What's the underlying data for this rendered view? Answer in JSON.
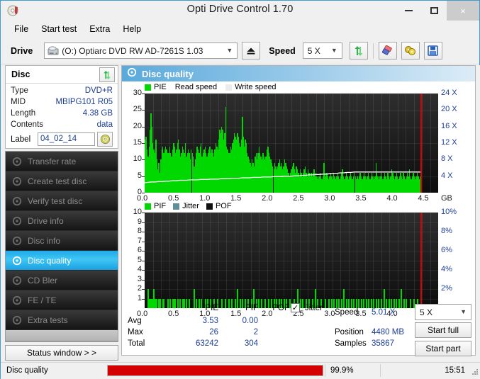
{
  "window": {
    "title": "Opti Drive Control 1.70",
    "icon": "disc-icon",
    "minimize_label": "minimize",
    "maximize_label": "maximize",
    "close_label": "×"
  },
  "menu": {
    "items": [
      "File",
      "Start test",
      "Extra",
      "Help"
    ]
  },
  "toolbar": {
    "drive_label": "Drive",
    "drive_value": "(O:)   Optiarc DVD RW AD-7261S 1.03",
    "eject_icon": "eject-icon",
    "speed_label": "Speed",
    "speed_value": "5 X",
    "refresh_icon": "refresh-arrows-icon",
    "eraser_icon": "eraser-icon",
    "compare_icon": "compare-icon",
    "save_icon": "save-floppy-icon"
  },
  "disc": {
    "header": "Disc",
    "refresh_icon": "refresh-arrows-icon",
    "rows": [
      {
        "key": "Type",
        "value": "DVD+R"
      },
      {
        "key": "MID",
        "value": "MBIPG101 R05"
      },
      {
        "key": "Length",
        "value": "4.38 GB"
      },
      {
        "key": "Contents",
        "value": "data"
      }
    ],
    "label_key": "Label",
    "label_value": "04_02_14",
    "label_placeholder": "",
    "cd_button_icon": "cd-disc-icon"
  },
  "nav": {
    "items": [
      {
        "label": "Transfer rate",
        "icon": "disc-icon",
        "selected": false
      },
      {
        "label": "Create test disc",
        "icon": "disc-icon",
        "selected": false
      },
      {
        "label": "Verify test disc",
        "icon": "disc-icon",
        "selected": false
      },
      {
        "label": "Drive info",
        "icon": "disc-icon",
        "selected": false
      },
      {
        "label": "Disc info",
        "icon": "disc-icon",
        "selected": false
      },
      {
        "label": "Disc quality",
        "icon": "disc-icon",
        "selected": true
      },
      {
        "label": "CD Bler",
        "icon": "disc-icon",
        "selected": false
      },
      {
        "label": "FE / TE",
        "icon": "disc-icon",
        "selected": false
      },
      {
        "label": "Extra tests",
        "icon": "disc-icon",
        "selected": false
      }
    ],
    "status_window_label": "Status window > >"
  },
  "panel": {
    "title": "Disc quality",
    "icon": "disc-quality-icon"
  },
  "stats": {
    "columns": [
      "PIE",
      "PIF",
      "POF"
    ],
    "rows": [
      {
        "label": "Avg",
        "pie": "3.53",
        "pif": "0.00",
        "pof": ""
      },
      {
        "label": "Max",
        "pie": "26",
        "pif": "2",
        "pof": ""
      },
      {
        "label": "Total",
        "pie": "63242",
        "pif": "304",
        "pof": ""
      }
    ],
    "jitter_label": "Jitter",
    "jitter_checked": true,
    "speed_label": "Speed",
    "speed_value": "5.01 X",
    "position_label": "Position",
    "position_value": "4480 MB",
    "samples_label": "Samples",
    "samples_value": "35867",
    "speed_select_value": "5 X",
    "start_full_label": "Start full",
    "start_part_label": "Start part"
  },
  "statusbar": {
    "task": "Disc quality",
    "progress_text": "99.9%",
    "progress_pct": 99.9,
    "time": "15:51"
  },
  "colors": {
    "pie_green": "#00d800",
    "pif_green": "#00d800",
    "jitter_blue": "#5f8f99",
    "pof_black": "#101010",
    "read_speed_white": "#ffffff",
    "accent_blue": "#1fa9e8",
    "progress_red": "#d40000",
    "value_blue": "#1c3f94"
  },
  "chart_data": [
    {
      "type": "area",
      "id": "pie-chart",
      "title": "",
      "legend": [
        {
          "label": "PIE",
          "color": "#00d800",
          "swatch": true
        },
        {
          "label": "Read speed",
          "color": "#ffffff",
          "swatch": false
        },
        {
          "label": "Write speed",
          "color": "#e8e8e8",
          "swatch": true
        }
      ],
      "xlabel": "GB",
      "ylabel": "",
      "xlim": [
        0,
        4.7
      ],
      "ylim": [
        0,
        30
      ],
      "yticks": [
        0,
        5,
        10,
        15,
        20,
        25,
        30
      ],
      "xticks": [
        0.0,
        0.5,
        1.0,
        1.5,
        2.0,
        2.5,
        3.0,
        3.5,
        4.0,
        4.5
      ],
      "xticklabels": [
        "0.0",
        "0.5",
        "1.0",
        "1.5",
        "2.0",
        "2.5",
        "3.0",
        "3.5",
        "4.0",
        "4.5"
      ],
      "y2lim": [
        0,
        24
      ],
      "y2ticks": [
        4,
        8,
        12,
        16,
        20,
        24
      ],
      "y2ticklabels": [
        "4 X",
        "8 X",
        "12 X",
        "16 X",
        "20 X",
        "24 X"
      ],
      "grid": true,
      "end_marker_gb": 4.42,
      "series": [
        {
          "name": "PIE",
          "color": "#00d800",
          "values": [
            16,
            17,
            13,
            11,
            14,
            19,
            24,
            20,
            15,
            13,
            12,
            16,
            10,
            7,
            9,
            6,
            10,
            13,
            14,
            12,
            13,
            14,
            13,
            12,
            12,
            14,
            12,
            11,
            13,
            15,
            14,
            12,
            13,
            15,
            16,
            13,
            11,
            12,
            14,
            13,
            12,
            15,
            11,
            12,
            13,
            12,
            10,
            13,
            12,
            11,
            8,
            10,
            12,
            14,
            13,
            12,
            14,
            15,
            11,
            12,
            13,
            14,
            12,
            11,
            12,
            13,
            14,
            12,
            13,
            12,
            11,
            13,
            15,
            14,
            13,
            16,
            19,
            18,
            20,
            19,
            16,
            18,
            26,
            14,
            13,
            12,
            12,
            14,
            13,
            15,
            16,
            18,
            17,
            16,
            18,
            17,
            15,
            14,
            16,
            23,
            17,
            14,
            16,
            15,
            12,
            11,
            10,
            9,
            8,
            10,
            9,
            8,
            11,
            12,
            10,
            12,
            14,
            12,
            11,
            10,
            12,
            11,
            10,
            11,
            13,
            14,
            12,
            11,
            10,
            9,
            8,
            7,
            9,
            8,
            7,
            8,
            9,
            10,
            8,
            9,
            7,
            8,
            10,
            9,
            8,
            7,
            6,
            5,
            6,
            7,
            8,
            9,
            7,
            6,
            8,
            7,
            6,
            5,
            7,
            6,
            5,
            6,
            7,
            8,
            6,
            5,
            7,
            6,
            5,
            6,
            5,
            6,
            7,
            5,
            6,
            5,
            4,
            5,
            6,
            5,
            4,
            5,
            9,
            6,
            5,
            6,
            5,
            4,
            5,
            6,
            5,
            4,
            6,
            5,
            4,
            5,
            6,
            5,
            4,
            5,
            6,
            7,
            5,
            4,
            5,
            6,
            5,
            4,
            5,
            6,
            5,
            4,
            5,
            6,
            5,
            4,
            5,
            4,
            5,
            6,
            5,
            4,
            5,
            6,
            5,
            4,
            5,
            6,
            5,
            4,
            5,
            6,
            5,
            4,
            5,
            9,
            6,
            5,
            4,
            5,
            6,
            5,
            4,
            5,
            6,
            5,
            4,
            6,
            5,
            4,
            5,
            7,
            6,
            5,
            4,
            5,
            6,
            5,
            4,
            5,
            6,
            5,
            4,
            6,
            5,
            4,
            5,
            6,
            5,
            7,
            5,
            4,
            5,
            6,
            5,
            4,
            5,
            6,
            5,
            4,
            5
          ]
        },
        {
          "name": "Read speed",
          "color": "#ffffff",
          "values_x_axis": "right",
          "values": [
            2.4,
            2.5,
            2.6,
            2.6,
            2.7,
            2.7,
            2.8,
            2.8,
            2.9,
            2.9,
            3.0,
            3.0,
            3.0,
            3.1,
            3.1,
            3.1,
            3.2,
            3.2,
            3.2,
            3.3,
            3.3,
            3.3,
            3.4,
            3.4,
            3.4,
            3.5,
            3.5,
            3.5,
            3.6,
            3.6,
            3.6,
            3.7,
            3.7,
            3.7,
            3.8,
            3.8,
            3.8,
            3.9,
            3.9,
            3.9,
            4.0,
            4.0,
            4.0,
            4.1,
            4.1,
            4.2,
            4.2,
            4.3,
            4.3,
            4.4,
            4.4,
            4.5,
            4.5,
            4.6,
            4.7,
            4.7,
            4.8,
            4.8,
            4.9,
            4.9,
            5.0,
            5.0,
            5.0,
            5.0,
            5.0,
            5.0,
            5.0,
            5.0,
            5.0,
            5.0,
            5.0,
            5.0,
            5.0,
            5.0,
            5.0,
            5.0,
            5.0,
            5.0,
            5.0,
            5.0
          ]
        }
      ]
    },
    {
      "type": "bar",
      "id": "pif-chart",
      "title": "",
      "legend": [
        {
          "label": "PIF",
          "color": "#00d800",
          "swatch": true
        },
        {
          "label": "Jitter",
          "color": "#5f8f99",
          "swatch": true
        },
        {
          "label": "POF",
          "color": "#101010",
          "swatch": true
        }
      ],
      "xlabel": "GB",
      "ylabel": "",
      "xlim": [
        0,
        4.7
      ],
      "ylim": [
        0,
        10
      ],
      "yticks": [
        1,
        2,
        3,
        4,
        5,
        6,
        7,
        8,
        9,
        10
      ],
      "xticks": [
        0.0,
        0.5,
        1.0,
        1.5,
        2.0,
        2.5,
        3.0,
        3.5,
        4.0,
        4.5
      ],
      "xticklabels": [
        "0.0",
        "0.5",
        "1.0",
        "1.5",
        "2.0",
        "2.5",
        "3.0",
        "3.5",
        "4.0",
        "4.5"
      ],
      "y2lim": [
        0,
        10
      ],
      "y2ticks": [
        2,
        4,
        6,
        8,
        10
      ],
      "y2ticklabels": [
        "2%",
        "4%",
        "6%",
        "8%",
        "10%"
      ],
      "grid": true,
      "end_marker_gb": 4.42,
      "series": [
        {
          "name": "PIF",
          "color": "#00d800",
          "spikes": [
            [
              0.04,
              2
            ],
            [
              0.06,
              1
            ],
            [
              0.08,
              1
            ],
            [
              0.1,
              1
            ],
            [
              0.12,
              1
            ],
            [
              0.14,
              2
            ],
            [
              0.16,
              1
            ],
            [
              0.18,
              1
            ],
            [
              0.22,
              1
            ],
            [
              0.24,
              1
            ],
            [
              0.28,
              1
            ],
            [
              0.3,
              1
            ],
            [
              0.36,
              1
            ],
            [
              0.4,
              1
            ],
            [
              0.44,
              1
            ],
            [
              0.46,
              1
            ],
            [
              0.48,
              1
            ],
            [
              0.52,
              1
            ],
            [
              0.56,
              1
            ],
            [
              0.6,
              1
            ],
            [
              0.62,
              1
            ],
            [
              0.66,
              1
            ],
            [
              0.7,
              1
            ],
            [
              0.78,
              2
            ],
            [
              0.82,
              1
            ],
            [
              0.86,
              1
            ],
            [
              0.9,
              1
            ],
            [
              0.96,
              1
            ],
            [
              1.0,
              1
            ],
            [
              1.04,
              1
            ],
            [
              1.1,
              1
            ],
            [
              1.16,
              1
            ],
            [
              1.22,
              1
            ],
            [
              1.28,
              1
            ],
            [
              1.34,
              1
            ],
            [
              1.38,
              1
            ],
            [
              1.44,
              1
            ],
            [
              1.48,
              2
            ],
            [
              1.52,
              1
            ],
            [
              1.56,
              1
            ],
            [
              1.6,
              1
            ],
            [
              1.64,
              1
            ],
            [
              1.7,
              1
            ],
            [
              1.74,
              2
            ],
            [
              1.78,
              1
            ],
            [
              1.82,
              1
            ],
            [
              1.86,
              1
            ],
            [
              1.92,
              1
            ],
            [
              1.98,
              1
            ],
            [
              2.02,
              1
            ],
            [
              2.06,
              1
            ],
            [
              2.1,
              1
            ],
            [
              2.14,
              1
            ],
            [
              2.18,
              1
            ],
            [
              2.22,
              1
            ],
            [
              2.26,
              1
            ],
            [
              2.32,
              1
            ],
            [
              2.38,
              1
            ],
            [
              2.44,
              2
            ],
            [
              2.48,
              1
            ],
            [
              2.52,
              1
            ],
            [
              2.58,
              1
            ],
            [
              2.62,
              1
            ],
            [
              2.68,
              1
            ],
            [
              2.72,
              2
            ],
            [
              2.76,
              1
            ],
            [
              2.82,
              1
            ],
            [
              2.88,
              1
            ],
            [
              2.94,
              1
            ],
            [
              2.98,
              1
            ],
            [
              3.02,
              1
            ],
            [
              3.06,
              1
            ],
            [
              3.1,
              1
            ],
            [
              3.14,
              1
            ],
            [
              3.18,
              2
            ],
            [
              3.22,
              1
            ],
            [
              3.26,
              1
            ],
            [
              3.3,
              1
            ],
            [
              3.34,
              1
            ],
            [
              3.38,
              1
            ],
            [
              3.42,
              1
            ],
            [
              3.46,
              1
            ],
            [
              3.5,
              1
            ],
            [
              3.54,
              1
            ],
            [
              3.58,
              1
            ],
            [
              3.62,
              1
            ],
            [
              3.66,
              1
            ],
            [
              3.7,
              1
            ],
            [
              3.74,
              1
            ],
            [
              3.78,
              1
            ],
            [
              3.82,
              2
            ],
            [
              3.86,
              1
            ],
            [
              3.9,
              1
            ],
            [
              3.94,
              1
            ],
            [
              3.98,
              1
            ],
            [
              4.02,
              1
            ],
            [
              4.06,
              1
            ],
            [
              4.1,
              2
            ],
            [
              4.14,
              1
            ],
            [
              4.18,
              1
            ],
            [
              4.24,
              1
            ],
            [
              4.3,
              1
            ],
            [
              4.36,
              1
            ]
          ]
        }
      ]
    }
  ]
}
